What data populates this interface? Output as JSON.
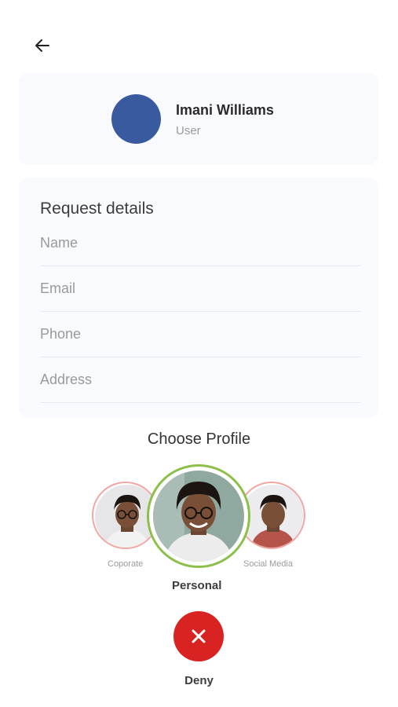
{
  "user": {
    "name": "Imani Williams",
    "role": "User"
  },
  "details": {
    "title": "Request details",
    "fields": [
      {
        "placeholder": "Name"
      },
      {
        "placeholder": "Email"
      },
      {
        "placeholder": "Phone"
      },
      {
        "placeholder": "Address"
      }
    ]
  },
  "profiles": {
    "title": "Choose Profile",
    "items": [
      {
        "label": "Coporate"
      },
      {
        "label": "Personal",
        "selected": true
      },
      {
        "label": "Social Media"
      }
    ]
  },
  "actions": {
    "deny_label": "Deny"
  },
  "colors": {
    "avatar": "#3a5a9f",
    "selected_ring": "#8cc04a",
    "unselected_ring": "#f0a7a3",
    "deny": "#d92323",
    "card_bg": "#f8fafe"
  },
  "icons": {
    "back": "arrow-left-icon",
    "deny": "close-icon"
  }
}
